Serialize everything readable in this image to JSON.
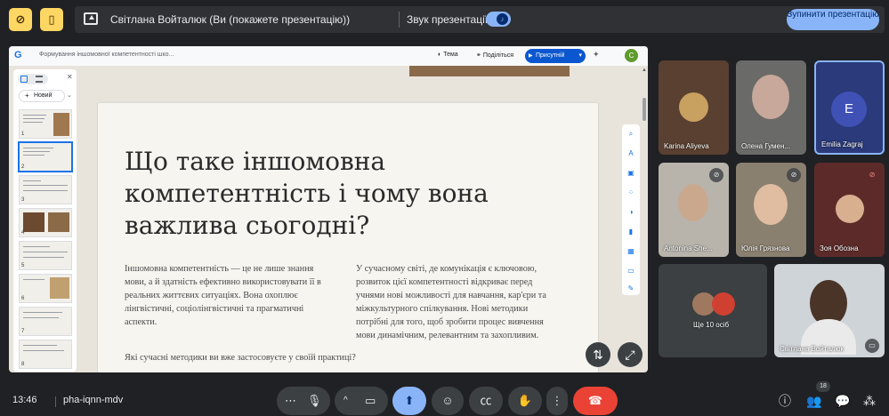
{
  "banner": {
    "presenter_text": "Світлана Войталюк (Ви (покажете презентацію))",
    "sound_label": "Звук презентації",
    "stop_button": "Зупинити презентацію"
  },
  "doc": {
    "title": "Формування іншомовної компетентності шко...",
    "theme_label": "Тема",
    "share_label": "Поділіться",
    "present_label": "Присутній",
    "user_initial": "C"
  },
  "thumbnails": {
    "new_label": "Новий",
    "items": [
      {
        "num": "1"
      },
      {
        "num": "2"
      },
      {
        "num": "3"
      },
      {
        "num": "4"
      },
      {
        "num": "5"
      },
      {
        "num": "6"
      },
      {
        "num": "7"
      },
      {
        "num": "8"
      }
    ]
  },
  "slide": {
    "title": "Що таке іншомовна компетентність і чому вона важлива сьогодні?",
    "col1": "Іншомовна компетентність — це не лише знання мови, а й здатність ефективно використовувати її в реальних життєвих ситуаціях. Вона охоплює лінгвістичні, соціолінгвістичні та прагматичні аспекти.",
    "col2": "У сучасному світі, де комунікація є ключовою, розвиток цієї компетентності відкриває перед учнями нові можливості для навчання, кар'єри та міжкультурного спілкування. Нові методики потрібні для того, щоб зробити процес вивчення мови динамічним, релевантним та захопливим.",
    "question": "Які сучасні методики ви вже застосовуєте у своїй практиці?"
  },
  "participants": [
    {
      "name": "Karina Aliyeva"
    },
    {
      "name": "Олена Гумен..."
    },
    {
      "name": "Emilia Zagraj",
      "initial": "E"
    },
    {
      "name": "Antonina She..."
    },
    {
      "name": "Юлія Грязнова"
    },
    {
      "name": "Зоя Обозна"
    },
    {
      "name": "Ще 10 осіб"
    },
    {
      "name": "Світлана Войталюк"
    }
  ],
  "bottom": {
    "time": "13:46",
    "meeting_code": "pha-iqnn-mdv",
    "participant_count": "18"
  },
  "colors": {
    "accent": "#8ab4f8",
    "end_call": "#ea4335",
    "alert_yellow": "#fdd663",
    "background": "#202124"
  }
}
